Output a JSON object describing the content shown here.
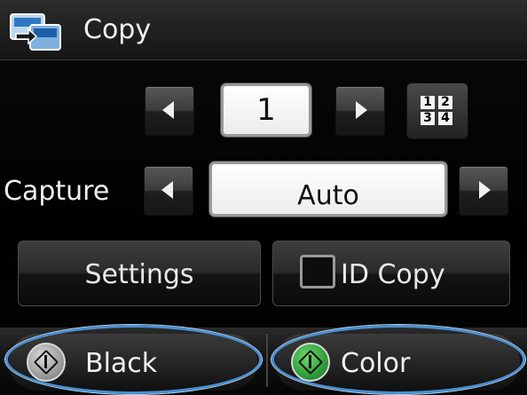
{
  "title": "Copy",
  "copies": {
    "value": "1"
  },
  "pages_icon": {
    "digits": [
      "1",
      "2",
      "3",
      "4"
    ]
  },
  "capture": {
    "label": "Capture",
    "value": "Auto"
  },
  "buttons": {
    "settings": "Settings",
    "id_copy": "ID Copy"
  },
  "start": {
    "black": "Black",
    "color": "Color"
  },
  "colors": {
    "highlight_ring": "#4a8fd0",
    "color_start": "#2e9d3a",
    "black_start": "#9c9c9c"
  },
  "icons": [
    "copy-app-icon",
    "left-arrow-icon",
    "right-arrow-icon",
    "pages-per-sheet-icon",
    "id-card-icon",
    "start-icon"
  ]
}
